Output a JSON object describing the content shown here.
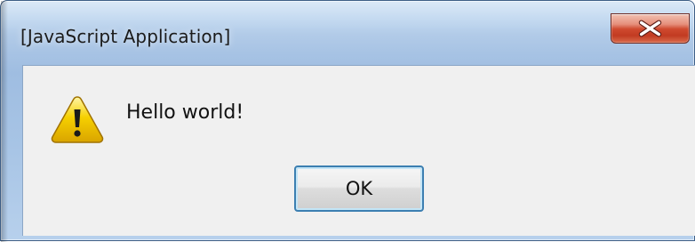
{
  "window": {
    "title": "[JavaScript Application]",
    "close_icon": "close-icon"
  },
  "dialog": {
    "message": "Hello world!",
    "icon": "warning-icon",
    "ok_label": "OK"
  },
  "colors": {
    "titlebar_gradient_top": "#dbe9f7",
    "titlebar_gradient_mid": "#a7c3e4",
    "client_background": "#f0f0f0",
    "close_button_red": "#c23b22",
    "ok_button_border": "#3c7fb1",
    "warning_yellow": "#f6d000"
  }
}
